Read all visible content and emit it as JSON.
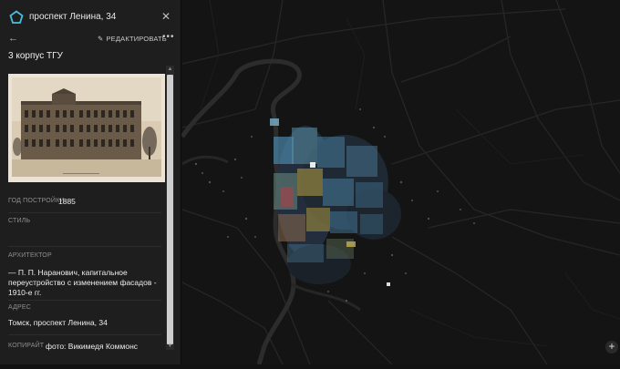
{
  "header": {
    "address_title": "проспект Ленина, 34",
    "logo_icon": "pentagon-logo-icon",
    "close_icon": "close-icon"
  },
  "toolbar": {
    "back_icon": "arrow-left-icon",
    "edit_label": "РЕДАКТИРОВАТЬ",
    "edit_icon": "pencil-icon",
    "more_icon": "more-horizontal-icon"
  },
  "building": {
    "name": "3 корпус ТГУ",
    "fields": {
      "year_label": "ГОД ПОСТРОЙКИ",
      "year_value": "1885",
      "style_label": "СТИЛЬ",
      "architect_label": "АРХИТЕКТОР",
      "architect_value": "— П. П. Наранович, капитальное переустройство с изменением фасадов - 1910-е гг.",
      "address_label": "АДРЕС",
      "address_value": "Томск, проспект Ленина, 34",
      "copyright_label": "КОПИРАЙТ",
      "copyright_value": "фото: Викимедя Коммонс"
    }
  },
  "map": {
    "zoom_in_icon": "plus-icon"
  },
  "colors": {
    "panel_bg": "#1e1e1e",
    "map_bg": "#141414",
    "building_blue": "#4a86a8",
    "building_yellow": "#b8a040",
    "building_red": "#a0434a"
  }
}
